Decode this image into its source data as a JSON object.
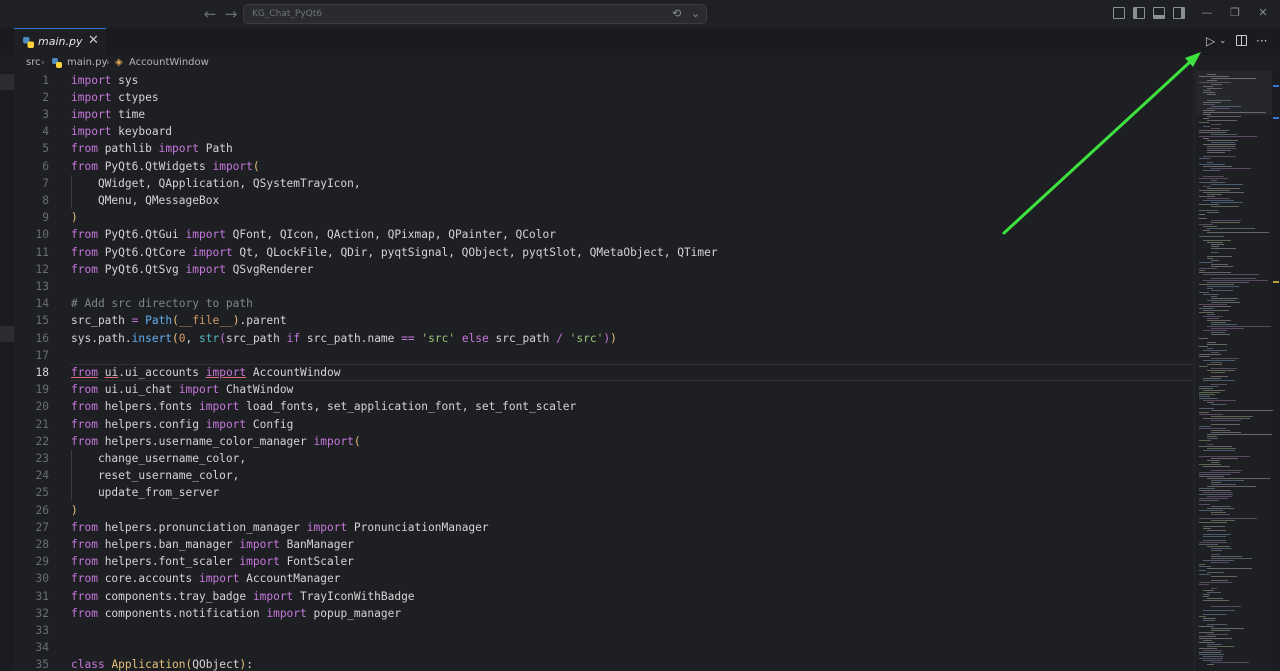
{
  "titlebar": {
    "command_center_text": "KG_Chat_PyQt6"
  },
  "tab": {
    "label": "main.py",
    "close_glyph": "✕"
  },
  "breadcrumb": {
    "folder": "src",
    "file": "main.py",
    "symbol": "AccountWindow"
  },
  "editor": {
    "active_line": 18,
    "line_numbers": [
      "1",
      "2",
      "3",
      "4",
      "5",
      "6",
      "7",
      "8",
      "9",
      "10",
      "11",
      "12",
      "13",
      "14",
      "15",
      "16",
      "17",
      "18",
      "19",
      "20",
      "21",
      "22",
      "23",
      "24",
      "25",
      "26",
      "27",
      "28",
      "29",
      "30",
      "31",
      "32",
      "33",
      "34",
      "35"
    ],
    "lines": [
      [
        {
          "t": "import",
          "c": "kw"
        },
        {
          "t": " sys"
        }
      ],
      [
        {
          "t": "import",
          "c": "kw"
        },
        {
          "t": " ctypes"
        }
      ],
      [
        {
          "t": "import",
          "c": "kw"
        },
        {
          "t": " time"
        }
      ],
      [
        {
          "t": "import",
          "c": "kw"
        },
        {
          "t": " keyboard"
        }
      ],
      [
        {
          "t": "from",
          "c": "kw"
        },
        {
          "t": " pathlib "
        },
        {
          "t": "import",
          "c": "kw"
        },
        {
          "t": " Path"
        }
      ],
      [
        {
          "t": "from",
          "c": "kw"
        },
        {
          "t": " PyQt6.QtWidgets "
        },
        {
          "t": "import",
          "c": "kw"
        },
        {
          "t": "(",
          "c": "pn"
        }
      ],
      [
        {
          "t": "    QWidget, QApplication, QSystemTrayIcon,"
        }
      ],
      [
        {
          "t": "    QMenu, QMessageBox"
        }
      ],
      [
        {
          "t": ")",
          "c": "pn"
        }
      ],
      [
        {
          "t": "from",
          "c": "kw"
        },
        {
          "t": " PyQt6.QtGui "
        },
        {
          "t": "import",
          "c": "kw"
        },
        {
          "t": " QFont, QIcon, QAction, QPixmap, QPainter, QColor"
        }
      ],
      [
        {
          "t": "from",
          "c": "kw"
        },
        {
          "t": " PyQt6.QtCore "
        },
        {
          "t": "import",
          "c": "kw"
        },
        {
          "t": " Qt, QLockFile, QDir, pyqtSignal, QObject, pyqtSlot, QMetaObject, QTimer"
        }
      ],
      [
        {
          "t": "from",
          "c": "kw"
        },
        {
          "t": " PyQt6.QtSvg "
        },
        {
          "t": "import",
          "c": "kw"
        },
        {
          "t": " QSvgRenderer"
        }
      ],
      [
        {
          "t": ""
        }
      ],
      [
        {
          "t": "# Add src directory to path",
          "c": "cm"
        }
      ],
      [
        {
          "t": "src_path "
        },
        {
          "t": "=",
          "c": "kw"
        },
        {
          "t": " "
        },
        {
          "t": "Path",
          "c": "fn"
        },
        {
          "t": "(",
          "c": "pn"
        },
        {
          "t": "__file__",
          "c": "nm"
        },
        {
          "t": ")",
          "c": "pn"
        },
        {
          "t": ".parent"
        }
      ],
      [
        {
          "t": "sys.path."
        },
        {
          "t": "insert",
          "c": "fn"
        },
        {
          "t": "(",
          "c": "pn"
        },
        {
          "t": "0",
          "c": "nm"
        },
        {
          "t": ", "
        },
        {
          "t": "str",
          "c": "bi"
        },
        {
          "t": "(",
          "c": "pn2"
        },
        {
          "t": "src_path "
        },
        {
          "t": "if",
          "c": "kw"
        },
        {
          "t": " src_path.name "
        },
        {
          "t": "==",
          "c": "kw"
        },
        {
          "t": " "
        },
        {
          "t": "'src'",
          "c": "str"
        },
        {
          "t": " "
        },
        {
          "t": "else",
          "c": "kw"
        },
        {
          "t": " src_path "
        },
        {
          "t": "/",
          "c": "kw"
        },
        {
          "t": " "
        },
        {
          "t": "'src'",
          "c": "str"
        },
        {
          "t": ")",
          "c": "pn2"
        },
        {
          "t": ")",
          "c": "pn"
        }
      ],
      [
        {
          "t": ""
        }
      ],
      [
        {
          "t": "from",
          "c": "kw err"
        },
        {
          "t": " "
        },
        {
          "t": "ui",
          "c": "err"
        },
        {
          "t": ".ui_accounts "
        },
        {
          "t": "import",
          "c": "kw err"
        },
        {
          "t": " AccountWindow"
        }
      ],
      [
        {
          "t": "from",
          "c": "kw"
        },
        {
          "t": " ui.ui_chat "
        },
        {
          "t": "import",
          "c": "kw"
        },
        {
          "t": " ChatWindow"
        }
      ],
      [
        {
          "t": "from",
          "c": "kw"
        },
        {
          "t": " helpers.fonts "
        },
        {
          "t": "import",
          "c": "kw"
        },
        {
          "t": " load_fonts, set_application_font, set_font_scaler"
        }
      ],
      [
        {
          "t": "from",
          "c": "kw"
        },
        {
          "t": " helpers.config "
        },
        {
          "t": "import",
          "c": "kw"
        },
        {
          "t": " Config"
        }
      ],
      [
        {
          "t": "from",
          "c": "kw"
        },
        {
          "t": " helpers.username_color_manager "
        },
        {
          "t": "import",
          "c": "kw"
        },
        {
          "t": "(",
          "c": "pn"
        }
      ],
      [
        {
          "t": "    change_username_color,"
        }
      ],
      [
        {
          "t": "    reset_username_color,"
        }
      ],
      [
        {
          "t": "    update_from_server"
        }
      ],
      [
        {
          "t": ")",
          "c": "pn"
        }
      ],
      [
        {
          "t": "from",
          "c": "kw"
        },
        {
          "t": " helpers.pronunciation_manager "
        },
        {
          "t": "import",
          "c": "kw"
        },
        {
          "t": " PronunciationManager"
        }
      ],
      [
        {
          "t": "from",
          "c": "kw"
        },
        {
          "t": " helpers.ban_manager "
        },
        {
          "t": "import",
          "c": "kw"
        },
        {
          "t": " BanManager"
        }
      ],
      [
        {
          "t": "from",
          "c": "kw"
        },
        {
          "t": " helpers.font_scaler "
        },
        {
          "t": "import",
          "c": "kw"
        },
        {
          "t": " FontScaler"
        }
      ],
      [
        {
          "t": "from",
          "c": "kw"
        },
        {
          "t": " core.accounts "
        },
        {
          "t": "import",
          "c": "kw"
        },
        {
          "t": " AccountManager"
        }
      ],
      [
        {
          "t": "from",
          "c": "kw"
        },
        {
          "t": " components.tray_badge "
        },
        {
          "t": "import",
          "c": "kw"
        },
        {
          "t": " TrayIconWithBadge"
        }
      ],
      [
        {
          "t": "from",
          "c": "kw"
        },
        {
          "t": " components.notification "
        },
        {
          "t": "import",
          "c": "kw"
        },
        {
          "t": " popup_manager"
        }
      ],
      [
        {
          "t": ""
        }
      ],
      [
        {
          "t": ""
        }
      ],
      [
        {
          "t": "class",
          "c": "kw"
        },
        {
          "t": " "
        },
        {
          "t": "Application",
          "c": "cls"
        },
        {
          "t": "(",
          "c": "pn"
        },
        {
          "t": "QObject"
        },
        {
          "t": ")",
          "c": "pn"
        },
        {
          "t": ":"
        }
      ]
    ]
  },
  "colors": {
    "accent": "#3477d6",
    "annotation_arrow": "#3ee23e",
    "keyword": "#c678dd",
    "function": "#61afef",
    "string": "#98c379",
    "comment": "#7f848e",
    "class": "#e5c07b"
  },
  "icons": {
    "back": "arrow-left-icon",
    "forward": "arrow-right-icon",
    "run": "run-python-file-icon",
    "split": "split-editor-icon",
    "more": "more-actions-icon"
  }
}
